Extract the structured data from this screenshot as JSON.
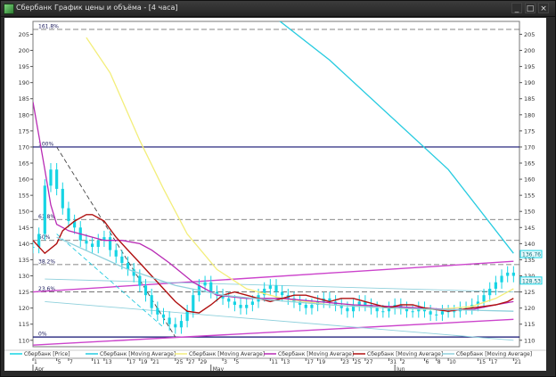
{
  "window": {
    "title": "Сбербанк График цены и объёма - [4 часа]",
    "buttons": [
      "_",
      "□",
      "×"
    ]
  },
  "chart_data": {
    "type": "line",
    "ylim": [
      108,
      209
    ],
    "y_ticks": [
      110,
      115,
      120,
      125,
      130,
      135,
      140,
      145,
      150,
      155,
      160,
      165,
      170,
      175,
      180,
      185,
      190,
      195,
      200,
      205
    ],
    "x_ticks": [
      {
        "label": "1",
        "t": 0
      },
      {
        "label": "5",
        "t": 4
      },
      {
        "label": "7",
        "t": 6
      },
      {
        "label": "11",
        "t": 10
      },
      {
        "label": "13",
        "t": 12
      },
      {
        "label": "17",
        "t": 16
      },
      {
        "label": "19",
        "t": 18
      },
      {
        "label": "21",
        "t": 20
      },
      {
        "label": "25",
        "t": 24
      },
      {
        "label": "27",
        "t": 26
      },
      {
        "label": "29",
        "t": 28
      },
      {
        "label": "3",
        "t": 32
      },
      {
        "label": "5",
        "t": 34
      },
      {
        "label": "11",
        "t": 40
      },
      {
        "label": "13",
        "t": 42
      },
      {
        "label": "17",
        "t": 46
      },
      {
        "label": "19",
        "t": 48
      },
      {
        "label": "23",
        "t": 52
      },
      {
        "label": "25",
        "t": 54
      },
      {
        "label": "27",
        "t": 56
      },
      {
        "label": "31",
        "t": 60
      },
      {
        "label": "2",
        "t": 62
      },
      {
        "label": "6",
        "t": 66
      },
      {
        "label": "8",
        "t": 68
      },
      {
        "label": "10",
        "t": 70
      },
      {
        "label": "15",
        "t": 75
      },
      {
        "label": "17",
        "t": 77
      },
      {
        "label": "21",
        "t": 81
      }
    ],
    "month_labels": [
      {
        "label": "Apr",
        "t": 0
      },
      {
        "label": "May",
        "t": 30
      },
      {
        "label": "Jun",
        "t": 61
      }
    ],
    "fib_levels": [
      {
        "label": "161.8%",
        "value": 206.5
      },
      {
        "label": "100%",
        "value": 170
      },
      {
        "label": "61.8%",
        "value": 147.5
      },
      {
        "label": "50%",
        "value": 141
      },
      {
        "label": "38.2%",
        "value": 133.5
      },
      {
        "label": "23.6%",
        "value": 125
      },
      {
        "label": "0%",
        "value": 111
      }
    ],
    "price_tags": [
      "136.76",
      "128.53"
    ],
    "series": [
      {
        "name": "Сбербанк [Price]",
        "color": "#16d4e4",
        "kind": "candles",
        "points": [
          [
            0,
            139
          ],
          [
            1,
            143
          ],
          [
            2,
            158
          ],
          [
            3,
            163
          ],
          [
            4,
            157
          ],
          [
            5,
            151
          ],
          [
            6,
            147
          ],
          [
            7,
            145
          ],
          [
            8,
            141
          ],
          [
            9,
            140
          ],
          [
            10,
            139
          ],
          [
            11,
            141
          ],
          [
            12,
            142
          ],
          [
            13,
            138
          ],
          [
            14,
            136
          ],
          [
            15,
            134
          ],
          [
            16,
            132
          ],
          [
            17,
            130
          ],
          [
            18,
            127
          ],
          [
            19,
            124
          ],
          [
            20,
            120
          ],
          [
            21,
            118
          ],
          [
            22,
            117
          ],
          [
            23,
            115
          ],
          [
            24,
            114
          ],
          [
            25,
            116
          ],
          [
            26,
            119
          ],
          [
            27,
            124
          ],
          [
            28,
            127
          ],
          [
            29,
            128
          ],
          [
            30,
            125
          ],
          [
            31,
            124
          ],
          [
            32,
            123
          ],
          [
            33,
            122
          ],
          [
            34,
            121
          ],
          [
            35,
            120
          ],
          [
            36,
            121
          ],
          [
            37,
            122
          ],
          [
            38,
            124
          ],
          [
            39,
            126
          ],
          [
            40,
            127
          ],
          [
            41,
            125
          ],
          [
            42,
            124
          ],
          [
            43,
            123
          ],
          [
            44,
            122
          ],
          [
            45,
            121
          ],
          [
            46,
            120
          ],
          [
            47,
            121
          ],
          [
            48,
            122
          ],
          [
            49,
            123
          ],
          [
            50,
            122
          ],
          [
            51,
            121
          ],
          [
            52,
            120
          ],
          [
            53,
            119
          ],
          [
            54,
            121
          ],
          [
            55,
            122
          ],
          [
            56,
            121
          ],
          [
            57,
            120
          ],
          [
            58,
            119
          ],
          [
            59,
            119
          ],
          [
            60,
            120
          ],
          [
            61,
            121
          ],
          [
            62,
            120
          ],
          [
            63,
            119
          ],
          [
            64,
            119
          ],
          [
            65,
            120
          ],
          [
            66,
            119
          ],
          [
            67,
            118
          ],
          [
            68,
            118
          ],
          [
            69,
            119
          ],
          [
            70,
            119
          ],
          [
            71,
            119
          ],
          [
            72,
            120
          ],
          [
            73,
            120
          ],
          [
            74,
            121
          ],
          [
            75,
            122
          ],
          [
            76,
            124
          ],
          [
            77,
            126
          ],
          [
            78,
            128
          ],
          [
            79,
            130
          ],
          [
            80,
            131
          ],
          [
            81,
            130
          ]
        ]
      },
      {
        "name": "Сбербанк [Moving Average]",
        "color": "#26cbe0",
        "points": [
          [
            20,
            240
          ],
          [
            34,
            220
          ],
          [
            50,
            197
          ],
          [
            70,
            163
          ],
          [
            81,
            137
          ]
        ]
      },
      {
        "name": "Сбербанк [Moving Average]",
        "color": "#f3ee7a",
        "points": [
          [
            9,
            204
          ],
          [
            13,
            193
          ],
          [
            18,
            172
          ],
          [
            22,
            157
          ],
          [
            26,
            143
          ],
          [
            31,
            132
          ],
          [
            36,
            126
          ],
          [
            42,
            123
          ],
          [
            50,
            121
          ],
          [
            60,
            120
          ],
          [
            68,
            119.5
          ],
          [
            74,
            120.5
          ],
          [
            78,
            123
          ],
          [
            81,
            126
          ]
        ]
      },
      {
        "name": "Сбербанк [Moving Average]",
        "color": "#b82ab4",
        "points": [
          [
            0,
            184
          ],
          [
            2,
            163
          ],
          [
            3,
            152
          ],
          [
            4,
            146
          ],
          [
            6,
            144
          ],
          [
            8,
            143
          ],
          [
            10,
            142
          ],
          [
            12,
            141
          ],
          [
            15,
            141
          ],
          [
            18,
            140
          ],
          [
            20,
            138
          ],
          [
            23,
            134
          ],
          [
            27,
            128
          ],
          [
            31,
            124
          ],
          [
            36,
            123
          ],
          [
            42,
            123
          ],
          [
            48,
            122
          ],
          [
            54,
            121
          ],
          [
            60,
            120.5
          ],
          [
            66,
            120
          ],
          [
            70,
            119.5
          ],
          [
            74,
            119.5
          ],
          [
            78,
            121
          ],
          [
            81,
            122
          ]
        ]
      },
      {
        "name": "Сбербанк [Moving Average]",
        "color": "#b01010",
        "points": [
          [
            0,
            141
          ],
          [
            2,
            137
          ],
          [
            4,
            140
          ],
          [
            5,
            144
          ],
          [
            7,
            147
          ],
          [
            9,
            149
          ],
          [
            10,
            149
          ],
          [
            12,
            147
          ],
          [
            14,
            142
          ],
          [
            16,
            138
          ],
          [
            18,
            134
          ],
          [
            20,
            130
          ],
          [
            22,
            126
          ],
          [
            24,
            122
          ],
          [
            26,
            119
          ],
          [
            28,
            118.5
          ],
          [
            30,
            121
          ],
          [
            32,
            124
          ],
          [
            34,
            125
          ],
          [
            36,
            124
          ],
          [
            38,
            123
          ],
          [
            40,
            122
          ],
          [
            42,
            123
          ],
          [
            44,
            124
          ],
          [
            46,
            124
          ],
          [
            48,
            123
          ],
          [
            50,
            122
          ],
          [
            52,
            123
          ],
          [
            54,
            123
          ],
          [
            56,
            122
          ],
          [
            58,
            121
          ],
          [
            60,
            120
          ],
          [
            62,
            121
          ],
          [
            64,
            121
          ],
          [
            66,
            120
          ],
          [
            68,
            119.5
          ],
          [
            70,
            119
          ],
          [
            72,
            119.5
          ],
          [
            74,
            120
          ],
          [
            76,
            120.5
          ],
          [
            78,
            121
          ],
          [
            80,
            122
          ],
          [
            81,
            123
          ]
        ]
      },
      {
        "name": "Сбербанк [Moving Average]",
        "color": "#8fd0dc",
        "points": [
          [
            4,
            142
          ],
          [
            10,
            137
          ],
          [
            16,
            132
          ],
          [
            24,
            127
          ],
          [
            32,
            124
          ],
          [
            40,
            122.5
          ],
          [
            50,
            121
          ],
          [
            60,
            120
          ],
          [
            70,
            119.5
          ],
          [
            81,
            119
          ]
        ]
      }
    ],
    "trendlines": [
      {
        "color": "#cc44cc",
        "points": [
          [
            0,
            125
          ],
          [
            81,
            134.5
          ]
        ]
      },
      {
        "color": "#cc44cc",
        "points": [
          [
            0,
            108.5
          ],
          [
            81,
            116.5
          ]
        ]
      },
      {
        "color": "#8fd0dc",
        "points": [
          [
            2,
            129
          ],
          [
            81,
            125
          ]
        ]
      },
      {
        "color": "#8fd0dc",
        "points": [
          [
            2,
            122
          ],
          [
            81,
            110
          ]
        ]
      },
      {
        "color": "#444444",
        "points": [
          [
            4,
            170
          ],
          [
            24,
            111
          ]
        ],
        "dashed": true
      },
      {
        "color": "#26cbe0",
        "points": [
          [
            4,
            143
          ],
          [
            22,
            114
          ]
        ],
        "dashed": true
      }
    ]
  }
}
